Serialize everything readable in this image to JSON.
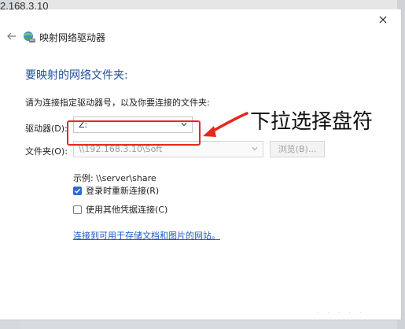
{
  "background": {
    "address_fragment": "2.168.3.10"
  },
  "dialog": {
    "close_icon": "close-icon",
    "back_icon": "arrow-left-icon",
    "title_icon": "network-drive-icon",
    "title": "映射网络驱动器",
    "heading": "要映射的网络文件夹:",
    "instruction": "请为连接指定驱动器号，以及你要连接的文件夹:",
    "drive": {
      "label": "驱动器(D):",
      "value": "Z:"
    },
    "folder": {
      "label": "文件夹(O):",
      "value": "\\\\192.168.3.10\\Soft",
      "browse_label": "浏览(B)..."
    },
    "example": "示例: \\\\server\\share",
    "reconnect": {
      "label": "登录时重新连接(R)",
      "checked": true
    },
    "other_credentials": {
      "label": "使用其他凭据连接(C)",
      "checked": false
    },
    "link": "连接到可用于存储文档和图片的网站。"
  },
  "annotation": {
    "text": "下拉选择盘符",
    "color": "#e8271d"
  },
  "colors": {
    "heading": "#1f4e9a",
    "link": "#1f57c8",
    "checkbox_accent": "#2f6ecf"
  }
}
